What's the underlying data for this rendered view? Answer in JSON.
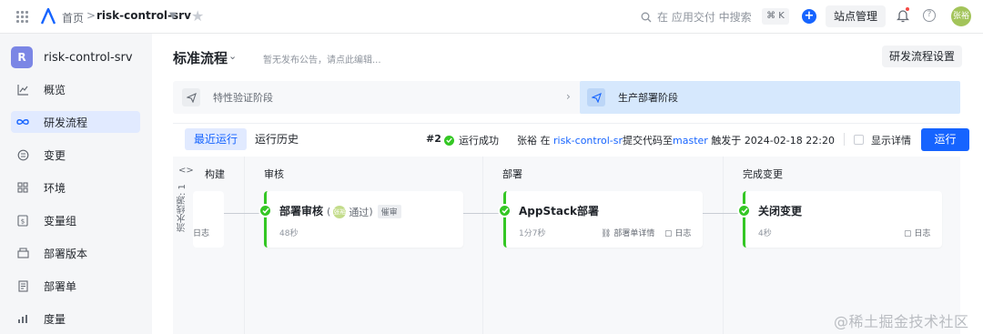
{
  "topbar": {
    "home": "首页",
    "separator": ">",
    "project": "risk-control-srv",
    "search_placeholder": "在 应用交付 中搜索",
    "shortcut": "⌘ K",
    "site_admin": "站点管理",
    "avatar_text": "张裕"
  },
  "sidebar": {
    "project_badge": "R",
    "project_name": "risk-control-srv",
    "items": [
      {
        "label": "概览",
        "icon": "chart-line-icon"
      },
      {
        "label": "研发流程",
        "icon": "infinity-icon",
        "active": true
      },
      {
        "label": "变更",
        "icon": "change-icon"
      },
      {
        "label": "环境",
        "icon": "environment-icon"
      },
      {
        "label": "变量组",
        "icon": "variable-icon"
      },
      {
        "label": "部署版本",
        "icon": "package-icon"
      },
      {
        "label": "部署单",
        "icon": "document-icon"
      },
      {
        "label": "度量",
        "icon": "bar-chart-icon"
      }
    ]
  },
  "main": {
    "title": "标准流程",
    "notice": "暂无发布公告，请点此编辑...",
    "settings_button": "研发流程设置"
  },
  "stages": {
    "first": "特性验证阶段",
    "second": "生产部署阶段"
  },
  "run": {
    "tabs": [
      "最近运行",
      "运行历史"
    ],
    "number": "#2",
    "status": "运行成功",
    "user": "张裕",
    "in_word": "在",
    "repo": "risk-control-sr",
    "commit_text": "提交代码至",
    "branch": "master",
    "trigger_text": "触发于",
    "time": "2024-02-18 22:20",
    "show_details": "显示详情",
    "run_button": "运行"
  },
  "board": {
    "pipeline_label": "流水线源: 1",
    "columns": [
      "构建",
      "审核",
      "部署",
      "完成变更"
    ],
    "build_log": "日志",
    "cards": {
      "review": {
        "title": "部署审核",
        "approver": "张裕",
        "approved": "通过",
        "remind": "催审",
        "duration": "48秒"
      },
      "deploy": {
        "title": "AppStack部署",
        "duration": "1分7秒",
        "details": "部署单详情",
        "log": "日志"
      },
      "close": {
        "title": "关闭变更",
        "duration": "4秒",
        "log": "日志"
      }
    }
  },
  "watermark": "@稀土掘金技术社区",
  "colors": {
    "primary": "#1664ff",
    "success": "#34c724",
    "active_bg": "#e1eaff",
    "stage_active_bg": "#d6e8fd"
  }
}
